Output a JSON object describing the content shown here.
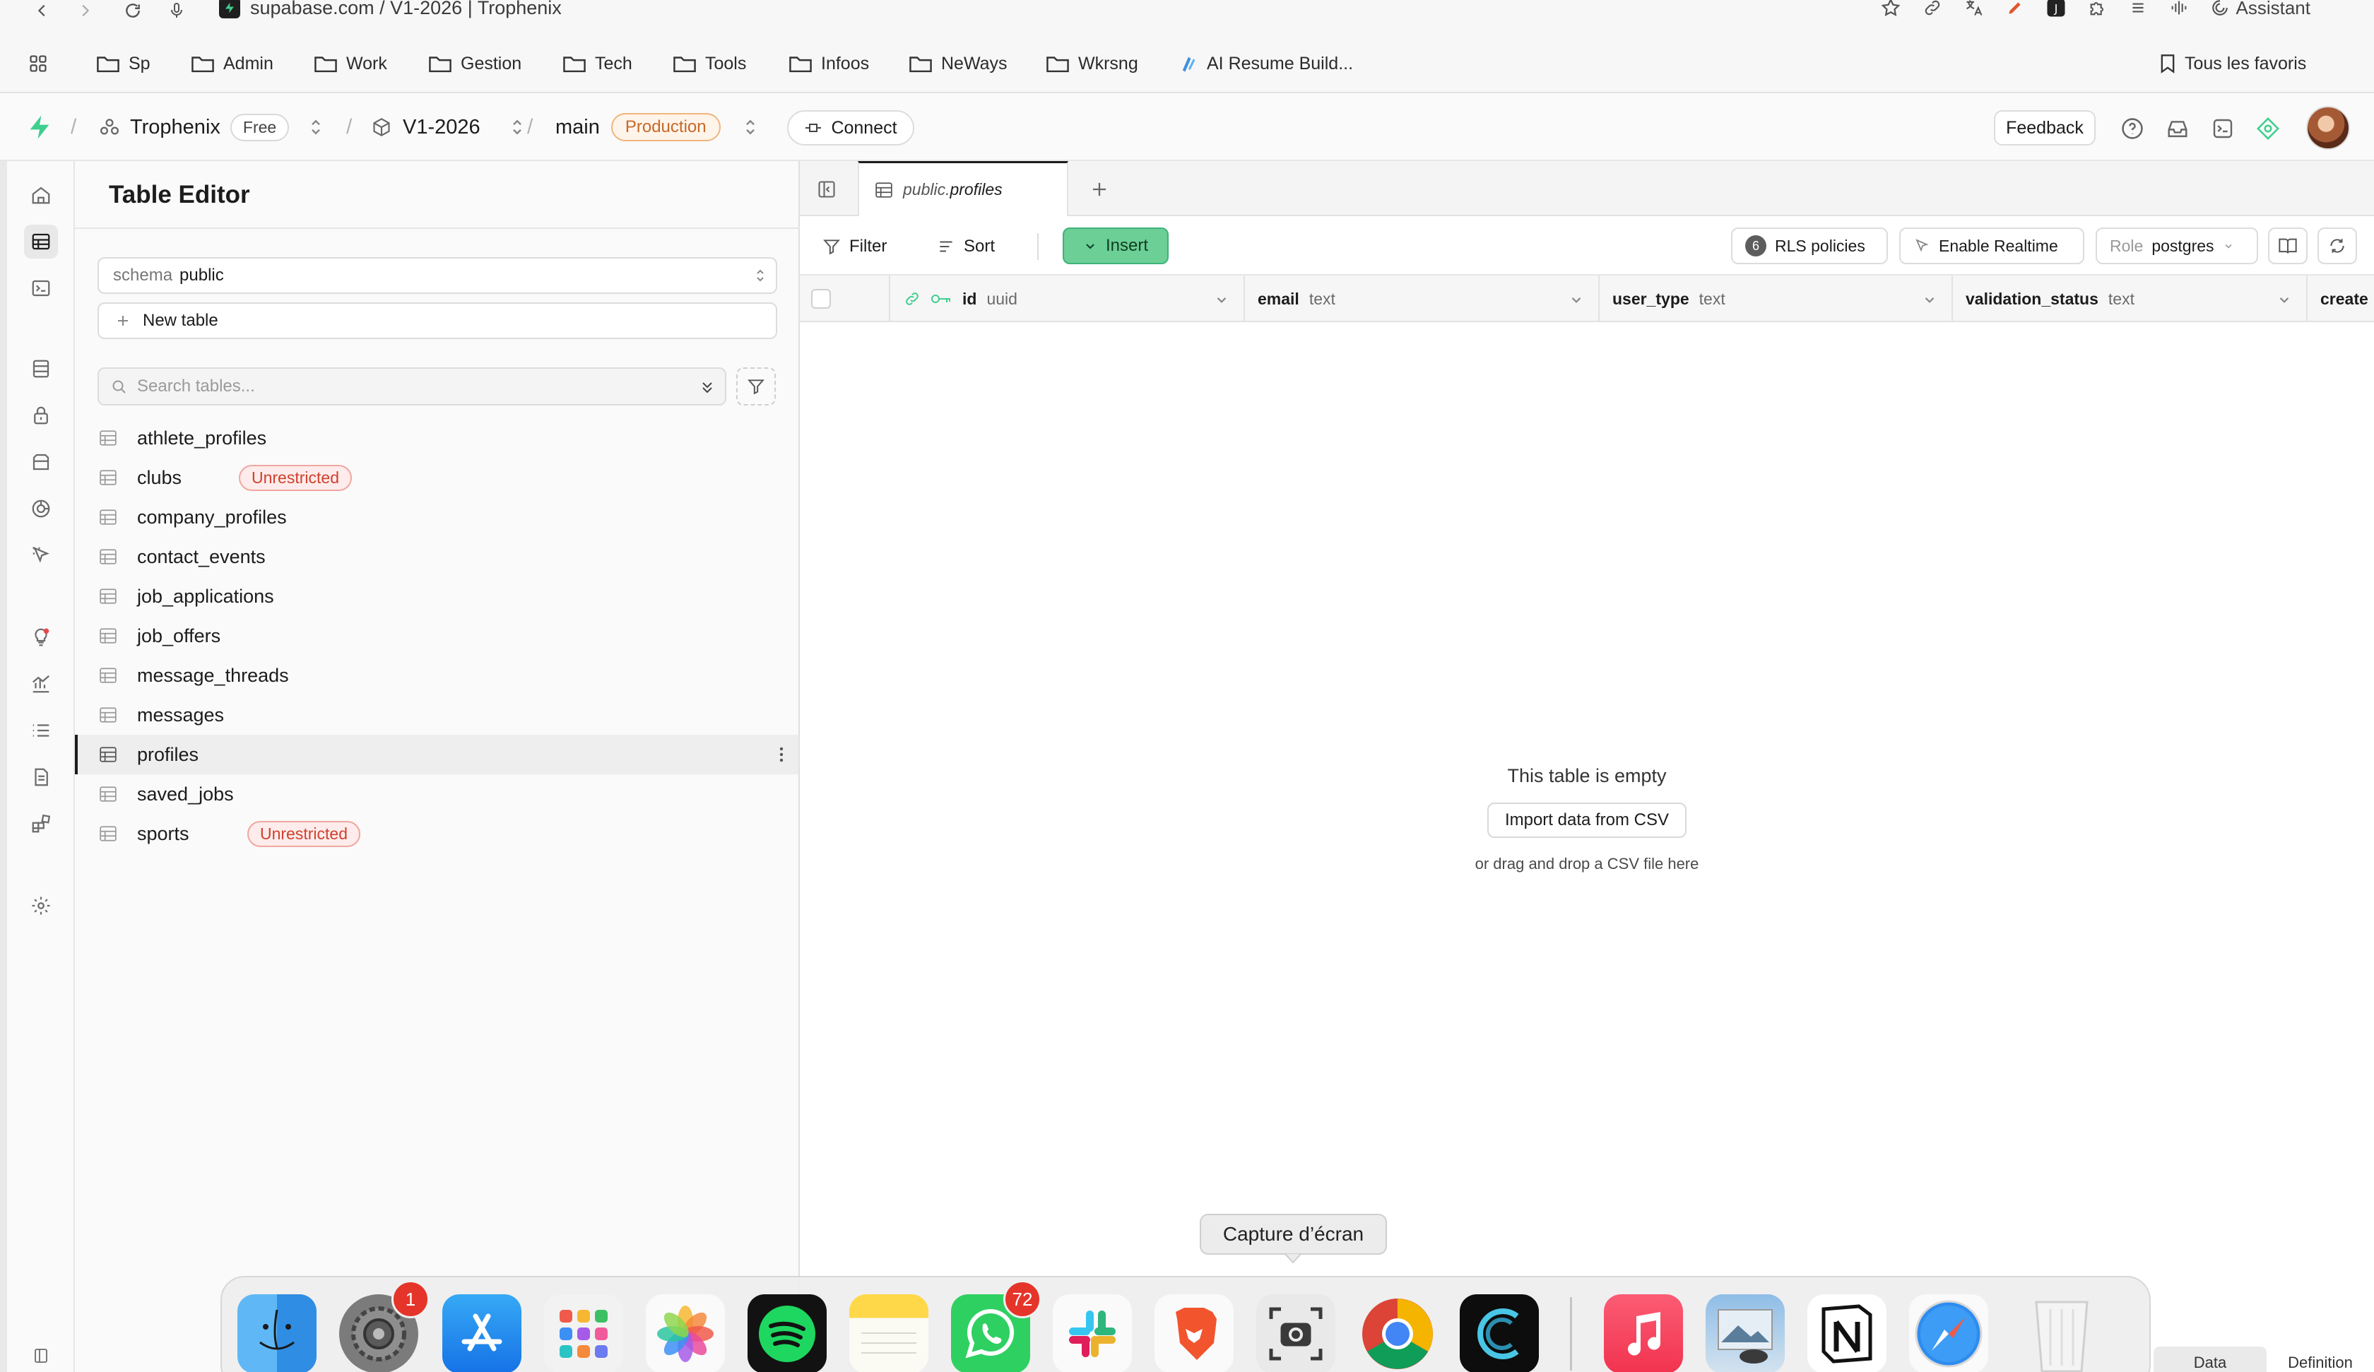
{
  "browser": {
    "url_text": "supabase.com / V1-2026 | Trophenix",
    "assistant_label": "Assistant"
  },
  "bookmarks": {
    "items": [
      {
        "label": "Sp"
      },
      {
        "label": "Admin"
      },
      {
        "label": "Work"
      },
      {
        "label": "Gestion"
      },
      {
        "label": "Tech"
      },
      {
        "label": "Tools"
      },
      {
        "label": "Infoos"
      },
      {
        "label": "NeWays"
      },
      {
        "label": "Wkrsng"
      },
      {
        "label": "AI Resume Build..."
      }
    ],
    "all_favorites": "Tous les favoris"
  },
  "header": {
    "org": "Trophenix",
    "plan": "Free",
    "project": "V1-2026",
    "branch": "main",
    "env": "Production",
    "connect": "Connect",
    "feedback": "Feedback"
  },
  "sidebar": {
    "title": "Table Editor",
    "schema_label": "schema",
    "schema_value": "public",
    "new_table": "New table",
    "search_placeholder": "Search tables...",
    "tables": [
      {
        "name": "athlete_profiles",
        "badge": ""
      },
      {
        "name": "clubs",
        "badge": "Unrestricted"
      },
      {
        "name": "company_profiles",
        "badge": ""
      },
      {
        "name": "contact_events",
        "badge": ""
      },
      {
        "name": "job_applications",
        "badge": ""
      },
      {
        "name": "job_offers",
        "badge": ""
      },
      {
        "name": "message_threads",
        "badge": ""
      },
      {
        "name": "messages",
        "badge": ""
      },
      {
        "name": "profiles",
        "badge": "",
        "selected": true
      },
      {
        "name": "saved_jobs",
        "badge": ""
      },
      {
        "name": "sports",
        "badge": "Unrestricted"
      }
    ]
  },
  "main": {
    "tab_schema": "public.",
    "tab_table": "profiles",
    "toolbar": {
      "filter": "Filter",
      "sort": "Sort",
      "insert": "Insert",
      "rls_count": "6",
      "rls": "RLS policies",
      "realtime": "Enable Realtime",
      "role_label": "Role",
      "role_value": "postgres"
    },
    "columns": [
      {
        "name": "id",
        "type": "uuid"
      },
      {
        "name": "email",
        "type": "text"
      },
      {
        "name": "user_type",
        "type": "text"
      },
      {
        "name": "validation_status",
        "type": "text"
      },
      {
        "name": "create",
        "type": ""
      }
    ],
    "empty_title": "This table is empty",
    "import_csv": "Import data from CSV",
    "empty_sub": "or drag and drop a CSV file here",
    "bottom_tabs": [
      "Data",
      "Definition"
    ]
  },
  "dock": {
    "tooltip": "Capture d’écran",
    "badges": {
      "settings": "1",
      "whatsapp": "72"
    },
    "apps": [
      "Finder",
      "System Settings",
      "App Store",
      "Launchpad",
      "Photos",
      "Spotify",
      "Notes",
      "WhatsApp",
      "Slack",
      "Brave",
      "Screenshot",
      "Chrome",
      "App",
      "Music",
      "Preview",
      "Notion",
      "Safari",
      "Trash"
    ]
  },
  "colors": {
    "brand_green": "#3ecf8e",
    "insert_bg": "#6ccf95",
    "prod_badge": "#c5692b",
    "unrestricted_badge": "#d0402f"
  }
}
